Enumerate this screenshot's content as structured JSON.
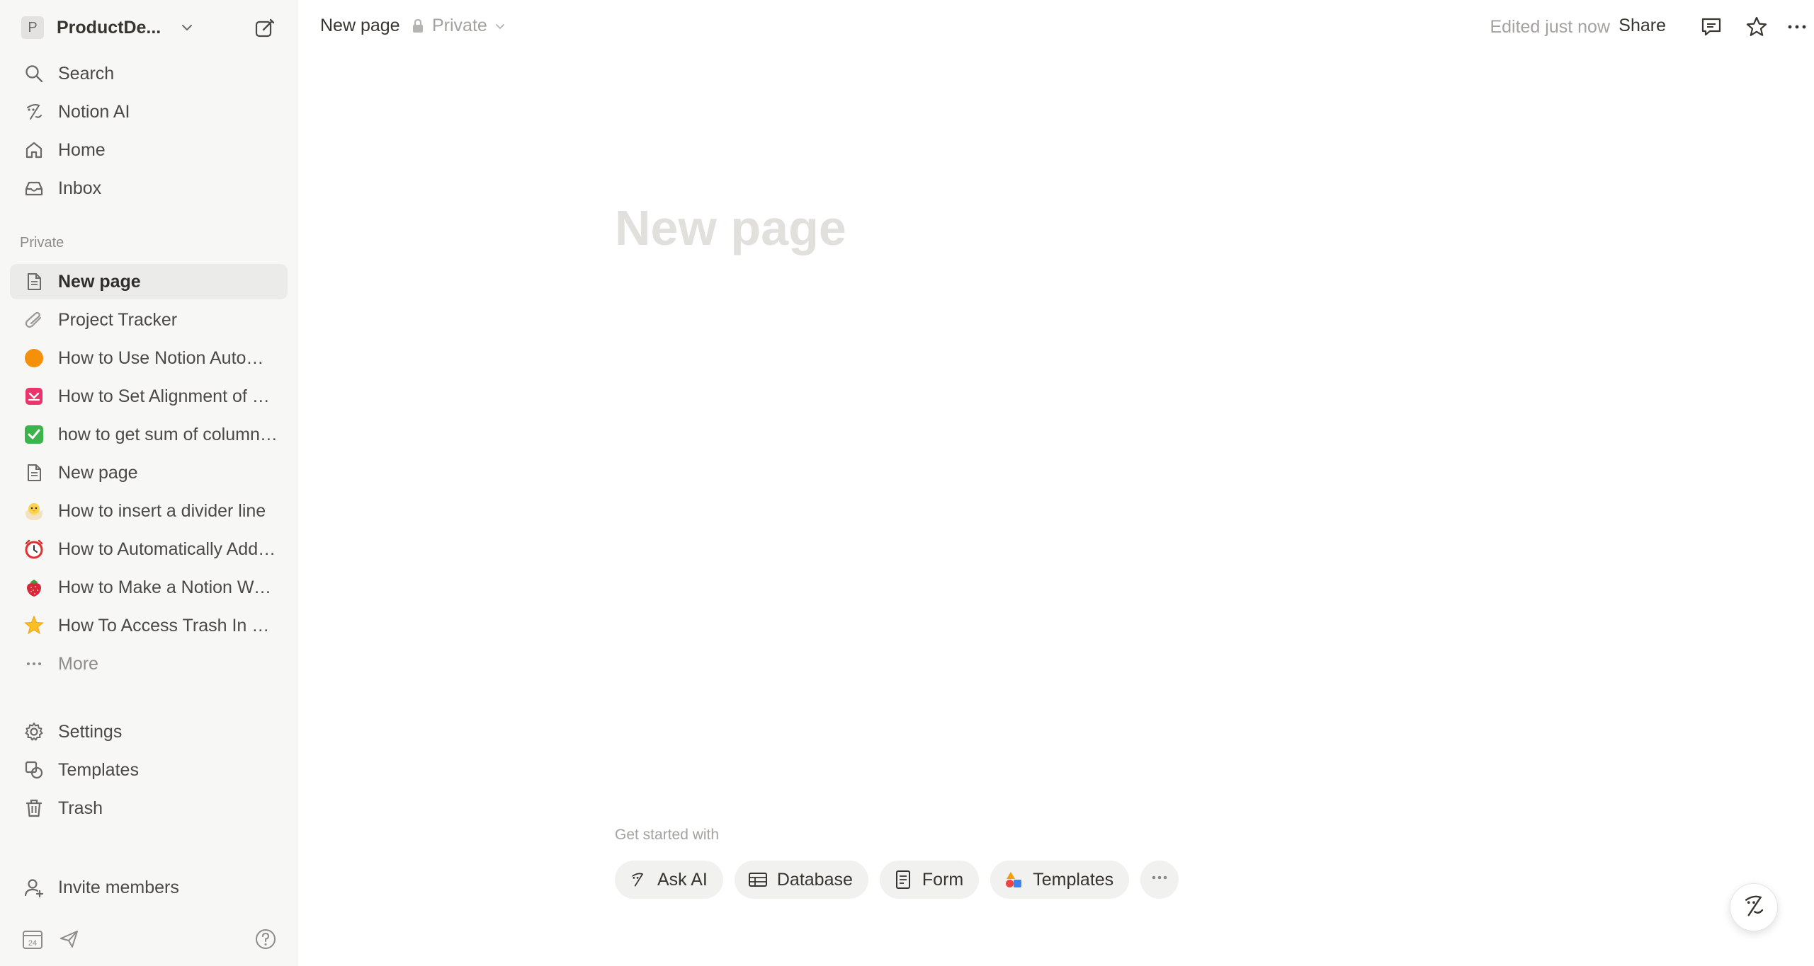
{
  "workspace": {
    "initial": "P",
    "name": "ProductDe..."
  },
  "sidebar": {
    "top_items": [
      {
        "label": "Search",
        "icon": "search-icon"
      },
      {
        "label": "Notion AI",
        "icon": "notion-ai-icon"
      },
      {
        "label": "Home",
        "icon": "home-icon"
      },
      {
        "label": "Inbox",
        "icon": "inbox-icon"
      }
    ],
    "section_label": "Private",
    "pages": [
      {
        "label": "New page",
        "icon": "page-icon",
        "active": true
      },
      {
        "label": "Project Tracker",
        "icon": "paperclip-icon"
      },
      {
        "label": "How to Use Notion Automations",
        "icon": "orange-circle-icon"
      },
      {
        "label": "How to Set Alignment of a Table",
        "icon": "pink-box-icon"
      },
      {
        "label": "how to get sum of column in notion",
        "icon": "green-check-icon"
      },
      {
        "label": "New page",
        "icon": "page-icon"
      },
      {
        "label": "How to insert a divider line",
        "icon": "chick-icon"
      },
      {
        "label": "How to Automatically Add Dates",
        "icon": "alarm-clock-icon"
      },
      {
        "label": "How to Make a Notion Website",
        "icon": "strawberry-icon"
      },
      {
        "label": "How To Access Trash In Notion",
        "icon": "star-emoji-icon"
      }
    ],
    "more_label": "More",
    "bottom_items": [
      {
        "label": "Settings",
        "icon": "gear-icon"
      },
      {
        "label": "Templates",
        "icon": "templates-icon"
      },
      {
        "label": "Trash",
        "icon": "trash-icon"
      }
    ],
    "invite_label": "Invite members",
    "calendar_day": "24"
  },
  "topbar": {
    "breadcrumb": "New page",
    "privacy": "Private",
    "edited": "Edited just now",
    "share": "Share"
  },
  "main": {
    "title_placeholder": "New page",
    "get_started": "Get started with",
    "chips": [
      {
        "label": "Ask AI",
        "icon": "notion-ai-icon"
      },
      {
        "label": "Database",
        "icon": "table-icon"
      },
      {
        "label": "Form",
        "icon": "form-icon"
      },
      {
        "label": "Templates",
        "icon": "templates-shapes-icon"
      }
    ]
  },
  "colors": {
    "sidebar_bg": "#f7f7f5",
    "active_bg": "#ebebea",
    "text": "#37352f",
    "muted": "#a3a29e",
    "title_placeholder": "#e1e0dd"
  }
}
